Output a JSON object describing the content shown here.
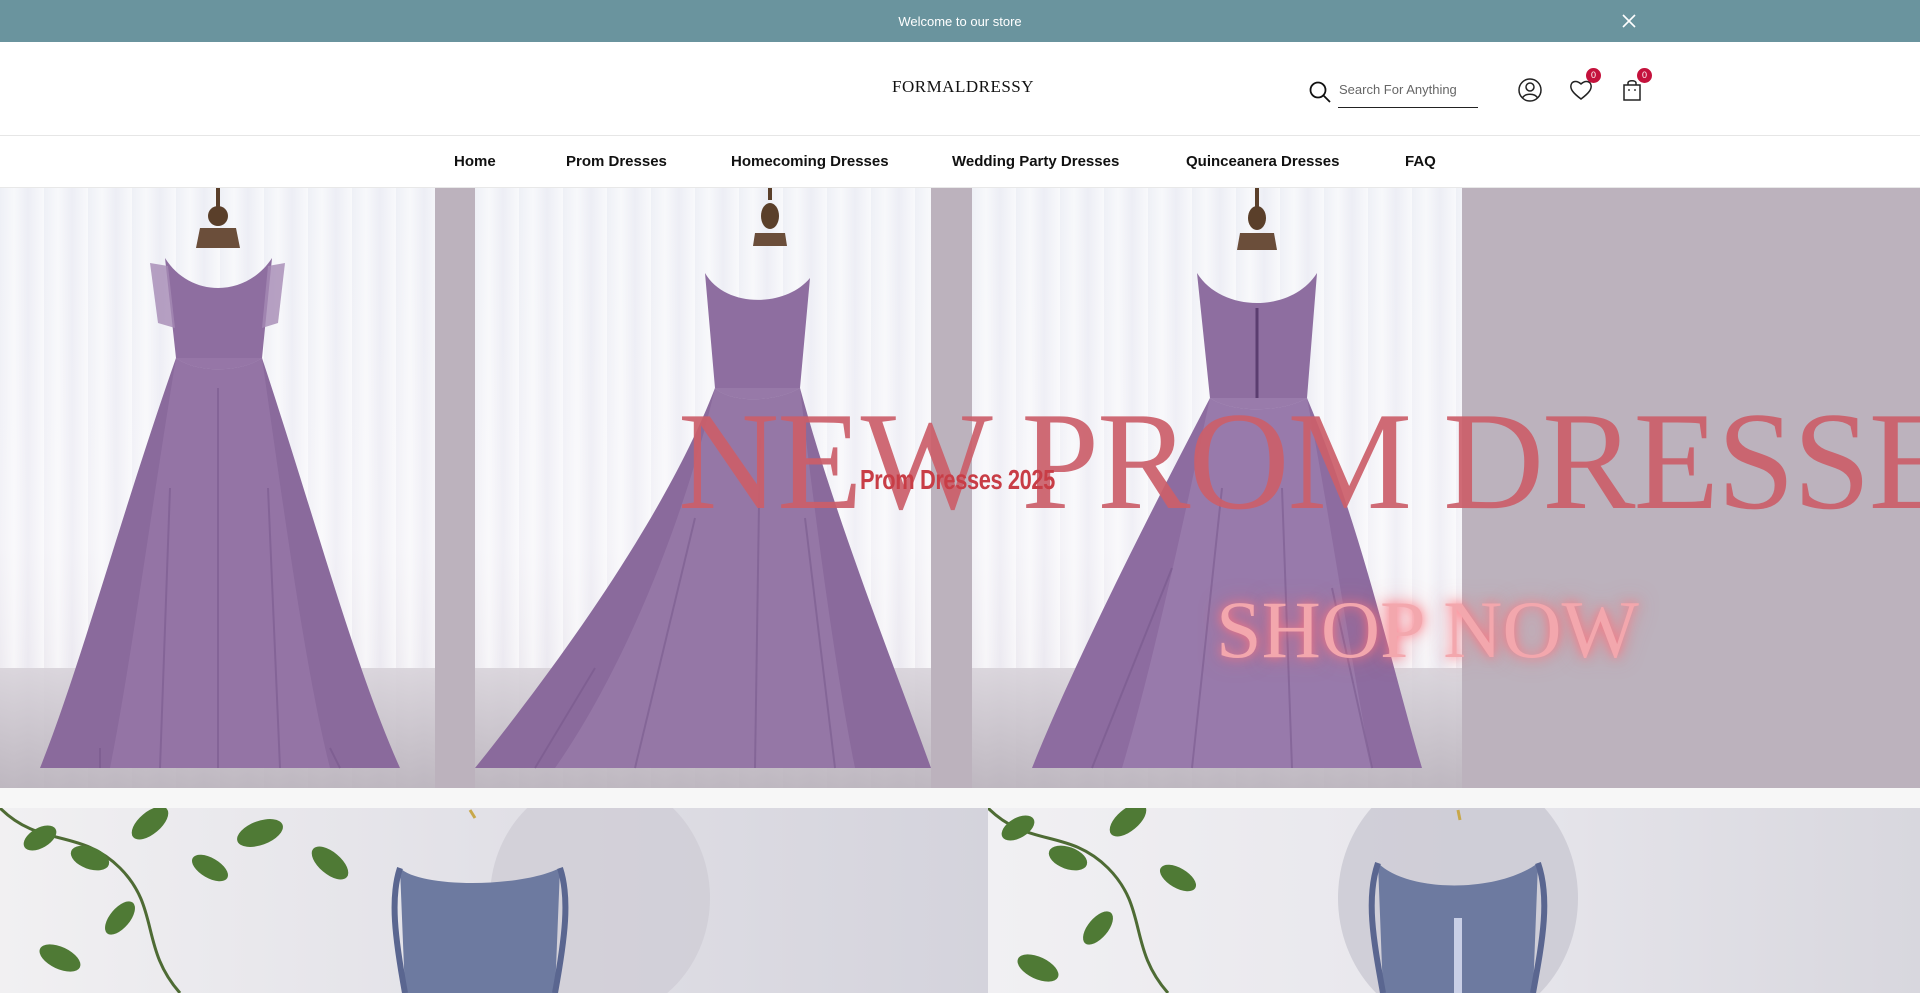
{
  "announcement": {
    "text": "Welcome to our store"
  },
  "header": {
    "logo": "FORMALDRESSY",
    "search": {
      "placeholder": "Search For Anything",
      "value": ""
    },
    "wishlist_count": "0",
    "cart_count": "0"
  },
  "nav": {
    "items": [
      {
        "label": "Home"
      },
      {
        "label": "Prom Dresses"
      },
      {
        "label": "Homecoming Dresses"
      },
      {
        "label": "Wedding Party Dresses"
      },
      {
        "label": "Quinceanera Dresses"
      },
      {
        "label": "FAQ"
      }
    ]
  },
  "hero": {
    "headline": "NEW PROM DRESSES",
    "subheading": "Prom Dresses 2025",
    "cta": "SHOP NOW"
  },
  "colors": {
    "announcement_bg": "#6a949e",
    "badge": "#c4123c",
    "headline": "#cc5f6a",
    "hero_bg": "#bcb2bd",
    "dress_purple": "#8b6a9e"
  },
  "icons": [
    "close-icon",
    "search-icon",
    "user-icon",
    "heart-icon",
    "shopping-bag-icon"
  ]
}
